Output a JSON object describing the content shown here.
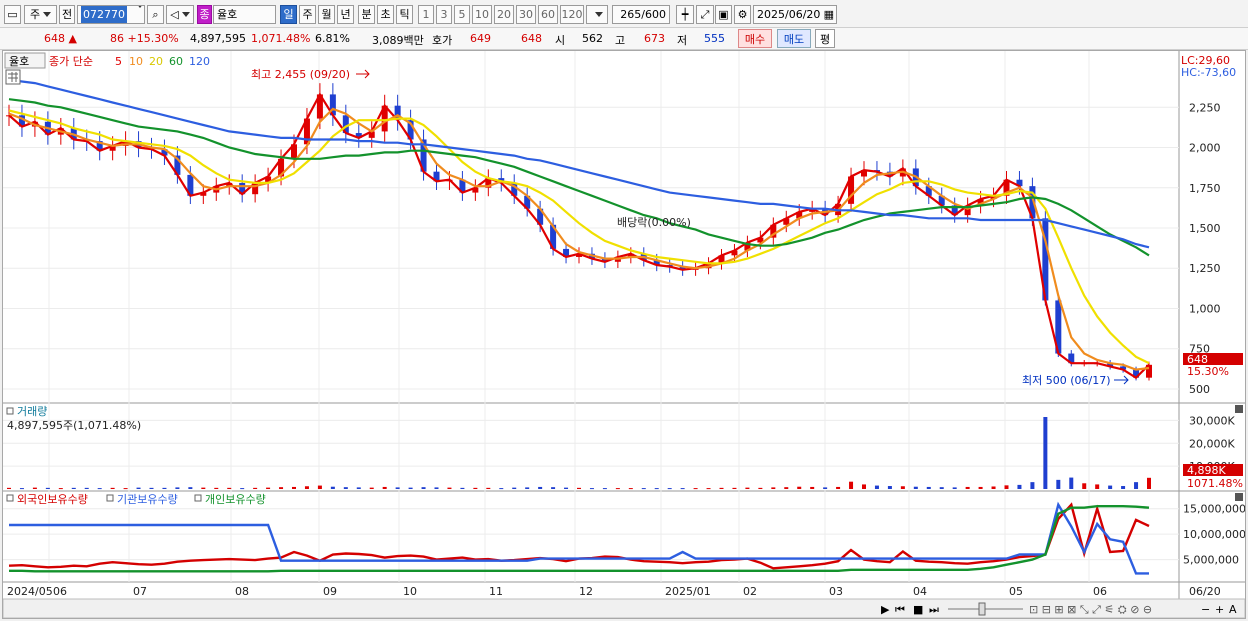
{
  "toolbar": {
    "market_label": "주",
    "prev_label": "전",
    "stock_code": "072770",
    "stock_name": "율호",
    "period_buttons": [
      "일",
      "주",
      "월",
      "년",
      "분",
      "초",
      "틱"
    ],
    "interval_buttons": [
      "1",
      "3",
      "5",
      "10",
      "20",
      "30",
      "60",
      "120"
    ],
    "count_display": "265",
    "count_total": "/600",
    "date": "2025/06/20",
    "badge_label": "종"
  },
  "quote": {
    "price": "648",
    "change_arrow": "▲",
    "change": "86",
    "change_pct": "+15.30%",
    "volume": "4,897,595",
    "volume_pct": "1,071.48%",
    "turnover_pct": "6.81%",
    "amount": "3,089백만",
    "bid_label": "호가",
    "bid": "649",
    "ask": "648",
    "open_label": "시",
    "open": "562",
    "high_label": "고",
    "high": "673",
    "low_label": "저",
    "low": "555",
    "buy_button": "매수",
    "sell_button": "매도",
    "eval_button": "평"
  },
  "chart": {
    "stock_tag": "율호",
    "ma_legend": {
      "prefix": "종가 단순",
      "items": [
        {
          "label": "5",
          "color": "#e00000"
        },
        {
          "label": "10",
          "color": "#f08c1e"
        },
        {
          "label": "20",
          "color": "#f0e000"
        },
        {
          "label": "60",
          "color": "#13922c"
        },
        {
          "label": "120",
          "color": "#2d5ee0"
        }
      ]
    },
    "lc": "LC:29,60",
    "hc": "HC:-73,60",
    "high_annot": "최고 2,455 (09/20)",
    "low_annot": "최저 500 (06/17)",
    "dividend_annot": "배당락(0.00%)",
    "current_price_tag": "648",
    "current_pct_tag": "15.30%",
    "volume_title": "거래량",
    "volume_info": "4,897,595주(1,071.48%)",
    "volume_tag": "4,898K",
    "volume_pct_tag": "1071.48%",
    "holdings_legend": [
      {
        "label": "외국인보유수량",
        "color": "#d40000"
      },
      {
        "label": "기관보유수량",
        "color": "#2d5ee0"
      },
      {
        "label": "개인보유수량",
        "color": "#13922c"
      }
    ],
    "price_ticks": [
      "2,250",
      "2,000",
      "1,750",
      "1,500",
      "1,250",
      "1,000",
      "750",
      "500"
    ],
    "volume_ticks": [
      "30,000K",
      "20,000K",
      "10,000K"
    ],
    "holding_ticks": [
      "15,000,000",
      "10,000,000",
      "5,000,000"
    ],
    "x_labels": [
      "2024/05",
      "06",
      "07",
      "08",
      "09",
      "10",
      "11",
      "12",
      "2025/01",
      "02",
      "03",
      "04",
      "05",
      "06",
      "06/20"
    ]
  },
  "chart_data": [
    {
      "type": "line",
      "title": "",
      "ylim": [
        450,
        2550
      ],
      "series": [
        {
          "name": "5",
          "values": [
            2200,
            2130,
            2160,
            2080,
            2120,
            2050,
            2040,
            1980,
            2010,
            2040,
            2000,
            1990,
            1950,
            1830,
            1700,
            1720,
            1760,
            1780,
            1710,
            1780,
            1820,
            1930,
            2020,
            2180,
            2330,
            2200,
            2090,
            2060,
            2100,
            2260,
            2170,
            2050,
            1850,
            1790,
            1800,
            1720,
            1750,
            1810,
            1780,
            1700,
            1620,
            1520,
            1370,
            1320,
            1340,
            1310,
            1290,
            1320,
            1340,
            1300,
            1270,
            1260,
            1240,
            1250,
            1280,
            1330,
            1360,
            1410,
            1440,
            1520,
            1560,
            1600,
            1620,
            1580,
            1650,
            1820,
            1860,
            1850,
            1820,
            1870,
            1760,
            1700,
            1640,
            1580,
            1640,
            1680,
            1700,
            1800,
            1760,
            1560,
            1050,
            720,
            660,
            660,
            660,
            640,
            620,
            570,
            650
          ]
        },
        {
          "name": "10",
          "values": [
            2210,
            2180,
            2140,
            2120,
            2100,
            2080,
            2050,
            2030,
            2010,
            2020,
            2020,
            2000,
            1990,
            1930,
            1840,
            1760,
            1740,
            1760,
            1760,
            1760,
            1780,
            1830,
            1910,
            2010,
            2160,
            2240,
            2210,
            2150,
            2100,
            2160,
            2200,
            2150,
            2020,
            1900,
            1830,
            1800,
            1760,
            1760,
            1790,
            1760,
            1700,
            1620,
            1510,
            1400,
            1350,
            1330,
            1310,
            1310,
            1320,
            1320,
            1300,
            1280,
            1260,
            1250,
            1260,
            1280,
            1310,
            1360,
            1400,
            1460,
            1510,
            1560,
            1590,
            1600,
            1610,
            1700,
            1780,
            1830,
            1840,
            1850,
            1820,
            1760,
            1700,
            1650,
            1620,
            1650,
            1680,
            1720,
            1750,
            1690,
            1420,
            1080,
            820,
            720,
            680,
            660,
            650,
            620,
            630
          ]
        },
        {
          "name": "20",
          "values": [
            2230,
            2210,
            2190,
            2170,
            2150,
            2120,
            2100,
            2080,
            2050,
            2040,
            2030,
            2020,
            2010,
            1990,
            1950,
            1890,
            1840,
            1800,
            1790,
            1780,
            1780,
            1800,
            1840,
            1910,
            1980,
            2070,
            2130,
            2170,
            2170,
            2170,
            2180,
            2180,
            2140,
            2070,
            1990,
            1910,
            1850,
            1810,
            1790,
            1780,
            1760,
            1720,
            1670,
            1600,
            1530,
            1470,
            1420,
            1390,
            1360,
            1340,
            1320,
            1310,
            1300,
            1290,
            1280,
            1280,
            1290,
            1310,
            1340,
            1370,
            1410,
            1450,
            1490,
            1530,
            1560,
            1610,
            1660,
            1710,
            1740,
            1780,
            1790,
            1790,
            1770,
            1740,
            1720,
            1710,
            1700,
            1710,
            1730,
            1720,
            1620,
            1440,
            1250,
            1080,
            950,
            850,
            770,
            700,
            660
          ]
        },
        {
          "name": "60",
          "values": [
            2300,
            2290,
            2280,
            2260,
            2250,
            2230,
            2210,
            2190,
            2170,
            2150,
            2130,
            2120,
            2110,
            2100,
            2080,
            2060,
            2030,
            2000,
            1980,
            1960,
            1950,
            1940,
            1930,
            1930,
            1930,
            1940,
            1950,
            1950,
            1960,
            1970,
            1970,
            1980,
            1980,
            1970,
            1960,
            1950,
            1940,
            1920,
            1900,
            1880,
            1850,
            1820,
            1790,
            1760,
            1730,
            1700,
            1670,
            1640,
            1610,
            1580,
            1560,
            1530,
            1510,
            1490,
            1460,
            1440,
            1420,
            1400,
            1390,
            1390,
            1400,
            1420,
            1440,
            1470,
            1490,
            1520,
            1550,
            1570,
            1590,
            1600,
            1610,
            1620,
            1630,
            1630,
            1630,
            1640,
            1650,
            1660,
            1680,
            1690,
            1680,
            1650,
            1610,
            1560,
            1510,
            1460,
            1420,
            1380,
            1330
          ]
        },
        {
          "name": "120",
          "values": [
            2420,
            2410,
            2400,
            2380,
            2360,
            2340,
            2320,
            2300,
            2280,
            2260,
            2240,
            2220,
            2200,
            2180,
            2160,
            2140,
            2120,
            2100,
            2090,
            2080,
            2070,
            2060,
            2060,
            2050,
            2050,
            2050,
            2050,
            2040,
            2040,
            2030,
            2030,
            2020,
            2020,
            2010,
            2000,
            1990,
            1980,
            1970,
            1960,
            1950,
            1930,
            1920,
            1900,
            1880,
            1860,
            1840,
            1820,
            1800,
            1780,
            1760,
            1740,
            1720,
            1710,
            1700,
            1690,
            1680,
            1670,
            1660,
            1650,
            1650,
            1640,
            1630,
            1620,
            1620,
            1610,
            1610,
            1600,
            1590,
            1580,
            1580,
            1570,
            1560,
            1560,
            1560,
            1560,
            1550,
            1550,
            1550,
            1550,
            1550,
            1550,
            1530,
            1510,
            1490,
            1470,
            1450,
            1430,
            1400,
            1380
          ]
        }
      ]
    },
    {
      "type": "bar",
      "title": "거래량",
      "ylim": [
        0,
        35000
      ],
      "values": [
        500,
        400,
        600,
        500,
        400,
        500,
        500,
        400,
        500,
        400,
        600,
        500,
        500,
        700,
        800,
        600,
        500,
        500,
        400,
        500,
        600,
        800,
        900,
        1200,
        1500,
        1000,
        800,
        700,
        600,
        900,
        700,
        600,
        800,
        700,
        600,
        500,
        500,
        500,
        400,
        600,
        700,
        900,
        800,
        600,
        500,
        400,
        400,
        400,
        400,
        400,
        400,
        400,
        400,
        400,
        400,
        500,
        500,
        600,
        500,
        700,
        800,
        1000,
        900,
        700,
        900,
        3200,
        2000,
        1500,
        1300,
        1200,
        1000,
        900,
        800,
        700,
        900,
        900,
        1100,
        1600,
        1800,
        3000,
        31500,
        4000,
        5000,
        2500,
        2000,
        1500,
        1300,
        3000,
        4898
      ]
    },
    {
      "type": "line",
      "title": "",
      "ylim": [
        1000000,
        17500000
      ],
      "series": [
        {
          "name": "외국인보유수량",
          "values": [
            3800000,
            3900000,
            3700000,
            3500000,
            3600000,
            3800000,
            3700000,
            4200000,
            4500000,
            4300000,
            4100000,
            4000000,
            4200000,
            4600000,
            4800000,
            4900000,
            5000000,
            5100000,
            5000000,
            4900000,
            5200000,
            5400000,
            6500000,
            5800000,
            4800000,
            6000000,
            6200000,
            6100000,
            5900000,
            5400000,
            5700000,
            5800000,
            5600000,
            5000000,
            5200000,
            5400000,
            5000000,
            5100000,
            4800000,
            4900000,
            5100000,
            5300000,
            5100000,
            4700000,
            5200000,
            5300000,
            5600000,
            5500000,
            5000000,
            4700000,
            4600000,
            4500000,
            4300000,
            4500000,
            4600000,
            4900000,
            5000000,
            5200000,
            4400000,
            3300000,
            3500000,
            3700000,
            3900000,
            4200000,
            4700000,
            6900000,
            5000000,
            4700000,
            4500000,
            6600000,
            4800000,
            4600000,
            4500000,
            4300000,
            4200000,
            4500000,
            4700000,
            5000000,
            5500000,
            5700000,
            6000000,
            13000000,
            15800000,
            6200000,
            15000000,
            6500000,
            6700000,
            12800000,
            11600000
          ]
        },
        {
          "name": "기관보유수량",
          "values": [
            11800000,
            11800000,
            11800000,
            11800000,
            11800000,
            11800000,
            11800000,
            11800000,
            11800000,
            11800000,
            11800000,
            11800000,
            11800000,
            11800000,
            11800000,
            11800000,
            11800000,
            11800000,
            11800000,
            11800000,
            11800000,
            4800000,
            4800000,
            4800000,
            4800000,
            4800000,
            4800000,
            4800000,
            4800000,
            4800000,
            4800000,
            4800000,
            4800000,
            4800000,
            4800000,
            4800000,
            4800000,
            4800000,
            4800000,
            4800000,
            4800000,
            5200000,
            5200000,
            5200000,
            5200000,
            5200000,
            5200000,
            5200000,
            5200000,
            5200000,
            5200000,
            5200000,
            6500000,
            5200000,
            5200000,
            5200000,
            5200000,
            5200000,
            5200000,
            5200000,
            5200000,
            5200000,
            5200000,
            5200000,
            5200000,
            5200000,
            5200000,
            5200000,
            5200000,
            5200000,
            5200000,
            5200000,
            5200000,
            5200000,
            5200000,
            5200000,
            5200000,
            5200000,
            6000000,
            6000000,
            6000000,
            15800000,
            11500000,
            6500000,
            12000000,
            9000000,
            8500000,
            2300000,
            2300000
          ]
        },
        {
          "name": "개인보유수량",
          "values": [
            2800000,
            2800000,
            2700000,
            2700000,
            2700000,
            2700000,
            2700000,
            2700000,
            2700000,
            2700000,
            2700000,
            2700000,
            2700000,
            2700000,
            2700000,
            2700000,
            2700000,
            2700000,
            2700000,
            2700000,
            2700000,
            2800000,
            2800000,
            2800000,
            2800000,
            2800000,
            2800000,
            2800000,
            2800000,
            2800000,
            2800000,
            2800000,
            2800000,
            2800000,
            2800000,
            2800000,
            2800000,
            2800000,
            2800000,
            2800000,
            2800000,
            2800000,
            2800000,
            2800000,
            2800000,
            2800000,
            2800000,
            2800000,
            2800000,
            2800000,
            2800000,
            2800000,
            2800000,
            2800000,
            2800000,
            2800000,
            2800000,
            2800000,
            2800000,
            2800000,
            2800000,
            2800000,
            2800000,
            2800000,
            2800000,
            3000000,
            3000000,
            3000000,
            3000000,
            3000000,
            3000000,
            3000000,
            3000000,
            3000000,
            3000000,
            3200000,
            3500000,
            4000000,
            4500000,
            5000000,
            6000000,
            14000000,
            15200000,
            15200000,
            15500000,
            15500000,
            15500000,
            15400000,
            15200000
          ]
        }
      ]
    }
  ]
}
